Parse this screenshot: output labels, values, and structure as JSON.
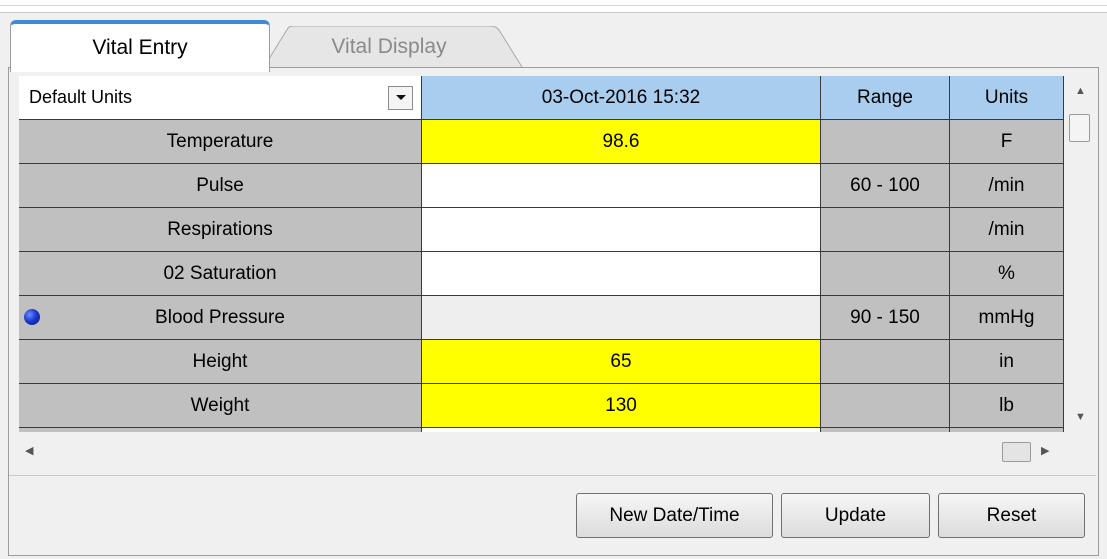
{
  "tabs": [
    {
      "label": "Vital Entry",
      "active": true
    },
    {
      "label": "Vital Display",
      "active": false
    }
  ],
  "units_selector": {
    "value": "Default Units"
  },
  "header": {
    "datetime": "03-Oct-2016 15:32",
    "range": "Range",
    "units": "Units"
  },
  "rows": [
    {
      "label": "Temperature",
      "value": "98.6",
      "range": "",
      "units": "F"
    },
    {
      "label": "Pulse",
      "value": "",
      "range": "60 - 100",
      "units": "/min"
    },
    {
      "label": "Respirations",
      "value": "",
      "range": "",
      "units": "/min"
    },
    {
      "label": "02 Saturation",
      "value": "",
      "range": "",
      "units": "%"
    },
    {
      "label": "Blood Pressure",
      "value": "",
      "range": "90 - 150",
      "units": "mmHg"
    },
    {
      "label": "Height",
      "value": "65",
      "range": "",
      "units": "in"
    },
    {
      "label": "Weight",
      "value": "130",
      "range": "",
      "units": "lb"
    }
  ],
  "buttons": {
    "new_datetime": "New Date/Time",
    "update": "Update",
    "reset": "Reset"
  },
  "colors": {
    "header": "#a9cdee",
    "entered_value": "#ffff00",
    "label_cell": "#c0c0c0",
    "indicator_dot": "#1d3ad0"
  },
  "icons": {
    "dropdown": "chevron-down-icon",
    "indicator": "blue-dot-icon"
  }
}
